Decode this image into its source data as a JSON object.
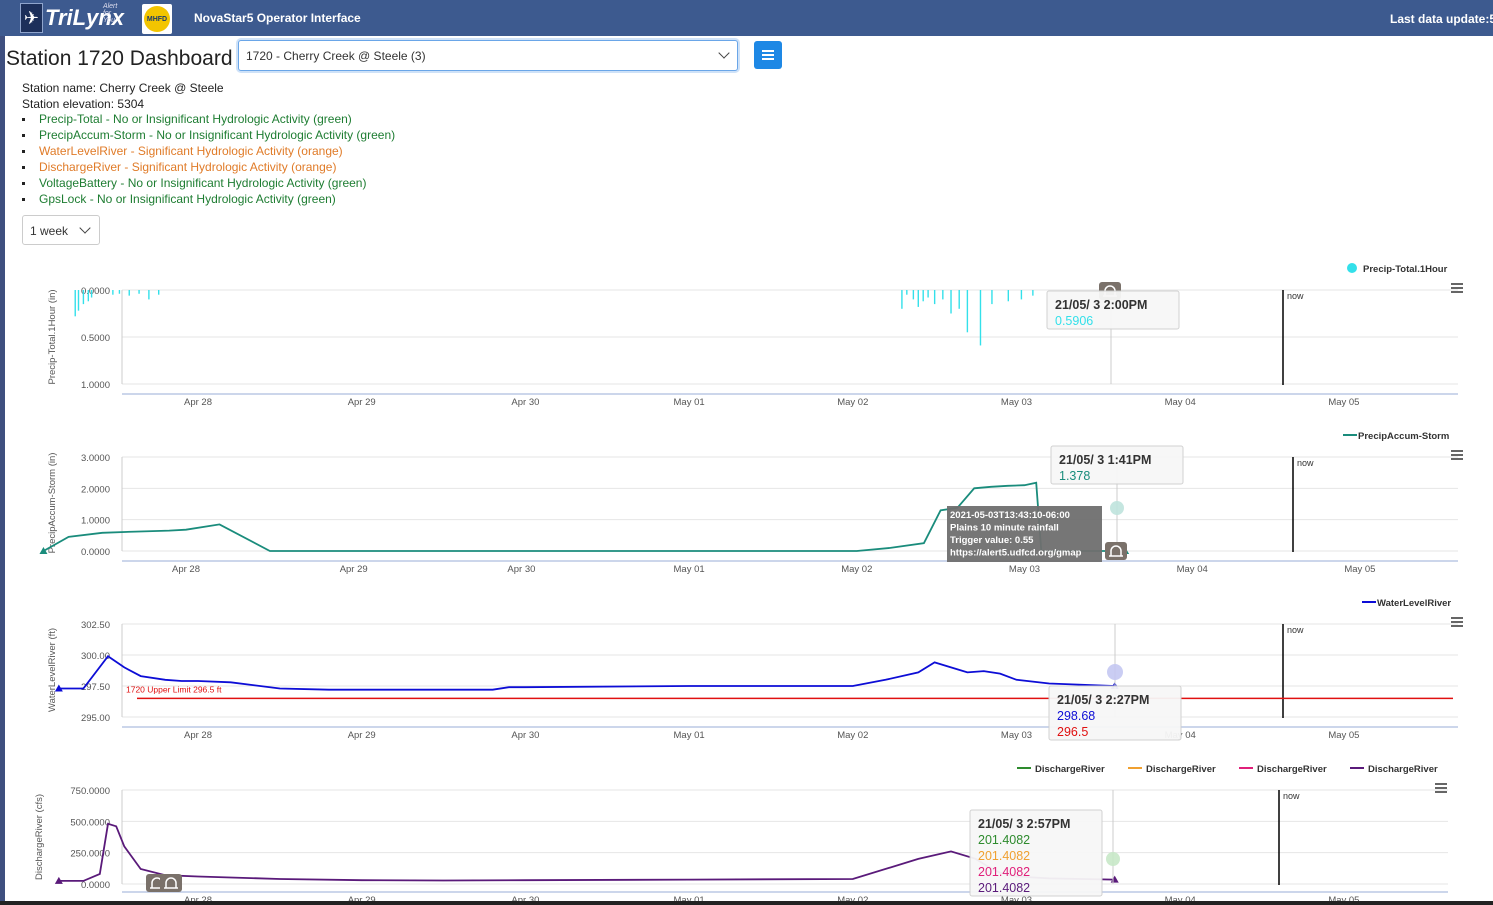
{
  "header": {
    "logo_text": "TriLynx",
    "logo_tagline": "Alert for You",
    "partner_logo_text": "MHFD",
    "app_title": "NovaStar5 Operator Interface",
    "last_update_label": "Last data update:5"
  },
  "dashboard": {
    "title": "Station 1720 Dashboard",
    "station_select_value": "1720 - Cherry Creek @ Steele (3)",
    "station_name": "Station name: Cherry Creek @ Steele",
    "station_elevation": "Station elevation: 5304",
    "statuses": [
      {
        "text": "Precip-Total - No or Insignificant Hydrologic Activity (green)",
        "level": "green"
      },
      {
        "text": "PrecipAccum-Storm - No or Insignificant Hydrologic Activity (green)",
        "level": "green"
      },
      {
        "text": "WaterLevelRiver - Significant Hydrologic Activity (orange)",
        "level": "orange"
      },
      {
        "text": "DischargeRiver - Significant Hydrologic Activity (orange)",
        "level": "orange"
      },
      {
        "text": "VoltageBattery - No or Insignificant Hydrologic Activity (green)",
        "level": "green"
      },
      {
        "text": "GpsLock - No or Insignificant Hydrologic Activity (green)",
        "level": "green"
      }
    ],
    "range_select_value": "1 week"
  },
  "colors": {
    "header_bg": "#3d5a8f",
    "precip_total": "#33e0ea",
    "precip_accum": "#1a8c7c",
    "water_level": "#0d0dd6",
    "upper_limit": "#e01010",
    "discharge_1": "#2e8b2e",
    "discharge_2": "#f0a030",
    "discharge_3": "#e0207a",
    "discharge_4": "#5a1a7a"
  },
  "x_axis_labels": [
    "Apr 28",
    "Apr 29",
    "Apr 30",
    "May 01",
    "May 02",
    "May 03",
    "May 04",
    "May 05"
  ],
  "now_label": "now",
  "chart_data": [
    {
      "type": "bar",
      "legend": [
        "Precip-Total.1Hour"
      ],
      "ylabel": "Precip-Total.1Hour (in)",
      "yticks": [
        "0.0000",
        "0.5000",
        "1.0000"
      ],
      "ylim": [
        0,
        1
      ],
      "reversed_y": true,
      "x_range_days": [
        "Apr 27",
        "May 05"
      ],
      "series": [
        {
          "name": "Precip-Total.1Hour",
          "x_days": [
            0.25,
            0.27,
            0.3,
            0.33,
            0.35,
            0.48,
            0.52,
            0.58,
            0.64,
            0.7,
            0.76,
            5.3,
            5.33,
            5.37,
            5.4,
            5.43,
            5.46,
            5.5,
            5.55,
            5.6,
            5.65,
            5.7,
            5.78,
            5.85,
            5.95,
            6.03,
            6.1
          ],
          "values": [
            0.28,
            0.22,
            0.15,
            0.12,
            0.08,
            0.05,
            0.04,
            0.06,
            0.04,
            0.1,
            0.05,
            0.2,
            0.05,
            0.1,
            0.18,
            0.12,
            0.08,
            0.15,
            0.1,
            0.25,
            0.2,
            0.45,
            0.59,
            0.15,
            0.12,
            0.1,
            0.06
          ]
        }
      ],
      "tooltip": {
        "title": "21/05/ 3 2:00PM",
        "values": [
          "0.5906"
        ]
      }
    },
    {
      "type": "line",
      "legend": [
        "PrecipAccum-Storm"
      ],
      "ylabel": "PrecipAccum-Storm (in)",
      "yticks": [
        "3.0000",
        "2.0000",
        "1.0000",
        "0.0000"
      ],
      "ylim": [
        0,
        3
      ],
      "series": [
        {
          "name": "PrecipAccum-Storm",
          "x_days": [
            0.15,
            0.3,
            0.5,
            0.7,
            0.9,
            1.0,
            1.2,
            1.5,
            2.0,
            3.0,
            4.0,
            5.0,
            5.2,
            5.4,
            5.5,
            5.6,
            5.7,
            5.8,
            5.9,
            6.0,
            6.07,
            6.1,
            6.2,
            6.5,
            6.6
          ],
          "values": [
            0.0,
            0.45,
            0.58,
            0.62,
            0.65,
            0.68,
            0.85,
            0.0,
            0.0,
            0.0,
            0.0,
            0.0,
            0.1,
            0.25,
            1.3,
            1.38,
            2.0,
            2.05,
            2.08,
            2.1,
            2.18,
            0.0,
            0.0,
            0.0,
            0.0
          ]
        }
      ],
      "tooltip": {
        "title": "21/05/ 3 1:41PM",
        "values": [
          "1.378"
        ]
      },
      "alert_box": [
        "2021-05-03T13:43:10-06:00",
        "Plains 10 minute rainfall",
        "Trigger value: 0.55",
        "https://alert5.udfcd.org/gmap"
      ]
    },
    {
      "type": "line",
      "legend": [
        "WaterLevelRiver"
      ],
      "ylabel": "WaterLevelRiver (ft)",
      "yticks": [
        "302.50",
        "300.00",
        "297.50",
        "295.00"
      ],
      "ylim": [
        295,
        302.5
      ],
      "threshold": {
        "label": "1720 Upper Limit 296.5 ft",
        "value": 296.5
      },
      "series": [
        {
          "name": "WaterLevelRiver",
          "x_days": [
            0.15,
            0.3,
            0.45,
            0.55,
            0.65,
            0.8,
            0.9,
            1.0,
            1.2,
            1.5,
            1.8,
            2.0,
            2.5,
            2.8,
            2.9,
            3.0,
            4.0,
            5.0,
            5.2,
            5.4,
            5.5,
            5.6,
            5.7,
            5.8,
            5.9,
            6.0,
            6.2,
            6.6
          ],
          "values": [
            297.3,
            297.3,
            299.9,
            299.0,
            298.3,
            298.0,
            297.9,
            297.9,
            297.8,
            297.3,
            297.2,
            297.2,
            297.2,
            297.2,
            297.4,
            297.4,
            297.5,
            297.5,
            298.0,
            298.6,
            299.4,
            299.0,
            298.6,
            298.7,
            298.5,
            298.0,
            297.7,
            297.5
          ]
        }
      ],
      "tooltip": {
        "title": "21/05/ 3 2:27PM",
        "values": [
          "298.68",
          "296.5"
        ]
      }
    },
    {
      "type": "line",
      "legend": [
        "DischargeRiver",
        "DischargeRiver",
        "DischargeRiver",
        "DischargeRiver"
      ],
      "ylabel": "DischargeRiver (cfs)",
      "yticks": [
        "750.0000",
        "500.0000",
        "250.0000",
        "0.0000"
      ],
      "ylim": [
        0,
        750
      ],
      "series": [
        {
          "name": "DischargeRiver",
          "x_days": [
            0.15,
            0.3,
            0.4,
            0.45,
            0.5,
            0.55,
            0.65,
            0.8,
            1.0,
            1.5,
            2.0,
            2.5,
            3.0,
            4.0,
            5.0,
            5.4,
            5.6,
            5.75,
            5.85,
            5.9,
            6.0,
            6.2,
            6.6
          ],
          "values": [
            25,
            25,
            80,
            480,
            460,
            300,
            120,
            70,
            60,
            40,
            30,
            28,
            30,
            35,
            40,
            200,
            260,
            201,
            120,
            90,
            60,
            45,
            35
          ]
        }
      ],
      "tooltip": {
        "title": "21/05/ 3 2:57PM",
        "values": [
          "201.4082",
          "201.4082",
          "201.4082",
          "201.4082"
        ]
      }
    }
  ]
}
